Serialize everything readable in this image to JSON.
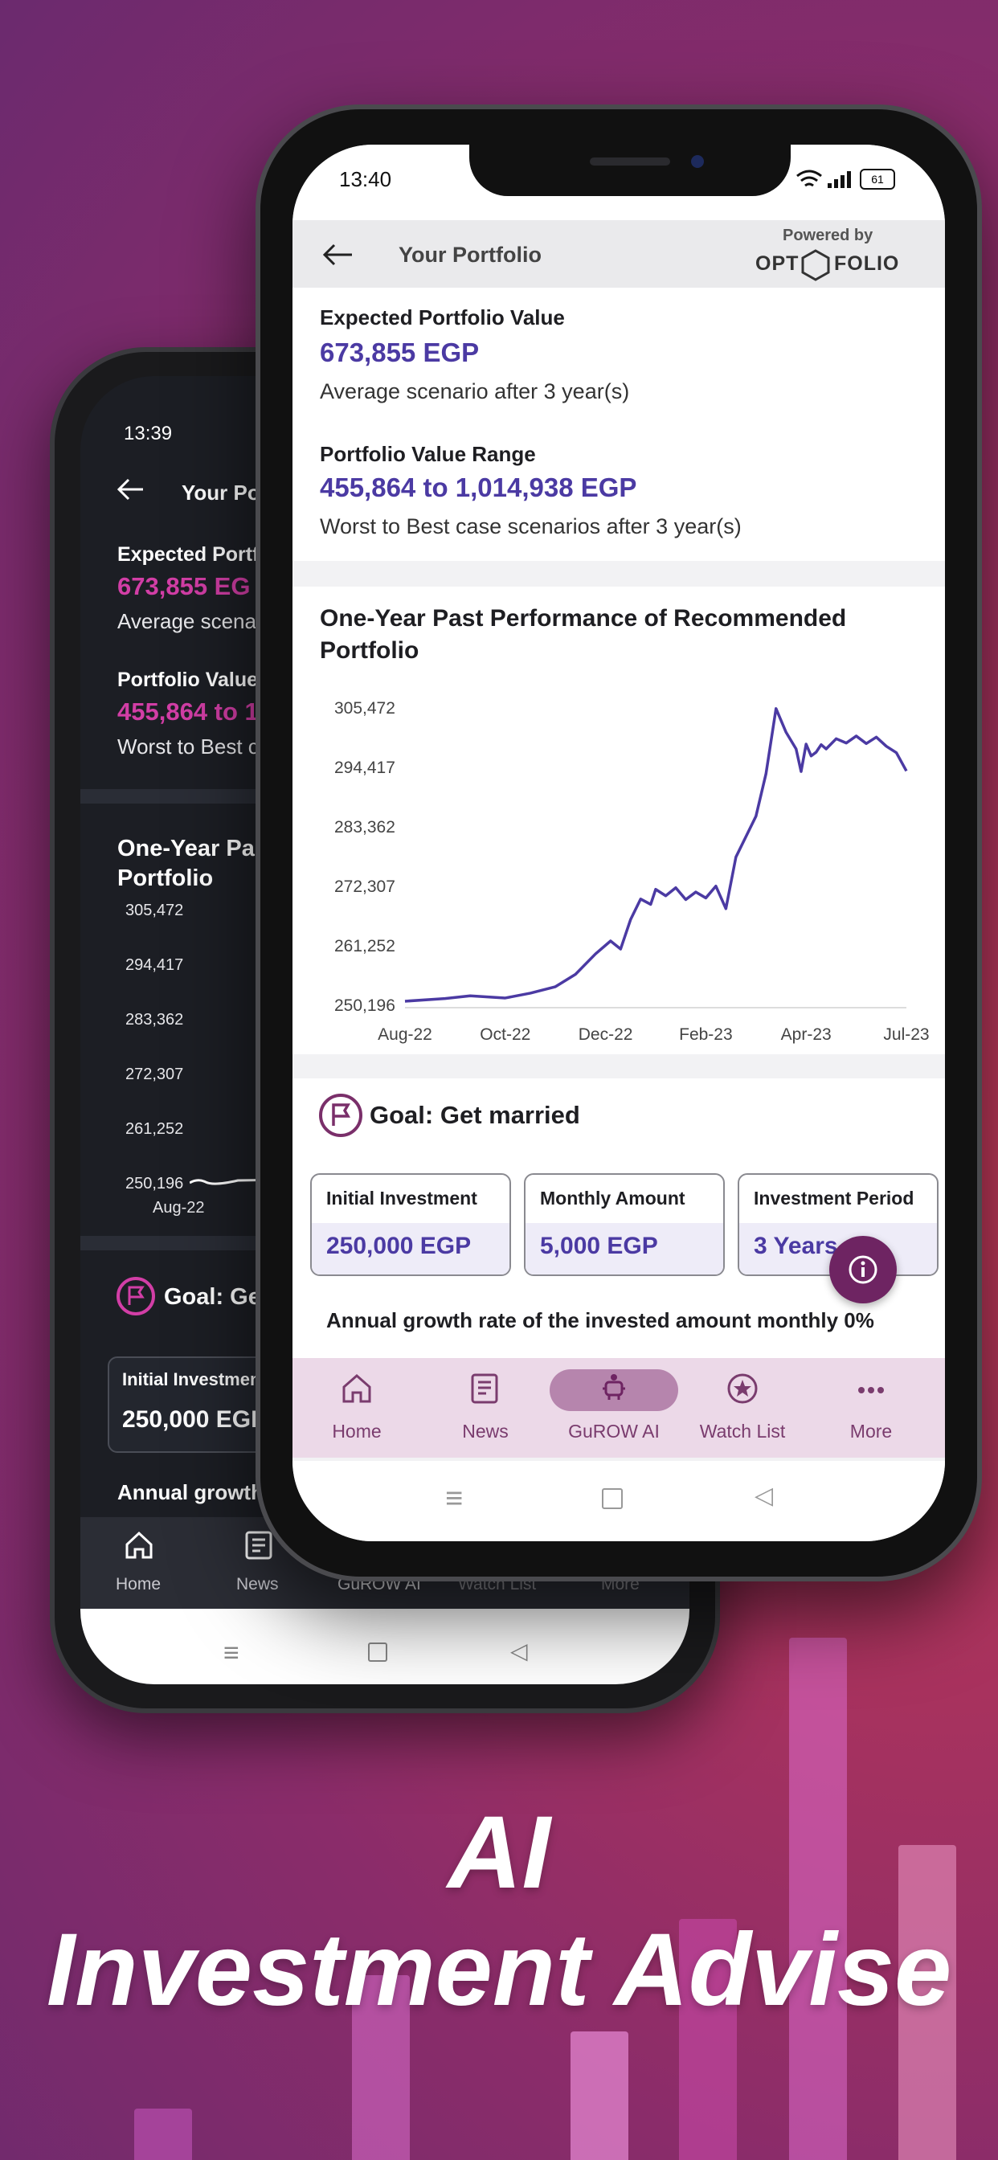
{
  "headline": {
    "line1": "AI",
    "line2": "Investment Advise"
  },
  "back_phone": {
    "time": "13:39",
    "title": "Your Po",
    "expected_label": "Expected Portf",
    "expected_value": "673,855 EG",
    "expected_sub": "Average scenar",
    "range_label": "Portfolio Value",
    "range_value": "455,864 to 1",
    "range_sub": "Worst to Best c",
    "chart_title": "One-Year Pas Portfolio",
    "y_ticks": [
      "305,472",
      "294,417",
      "283,362",
      "272,307",
      "261,252",
      "250,196"
    ],
    "x_tick": "Aug-22",
    "goal": "Goal: Get",
    "initial_label": "Initial Investment",
    "initial_value": "250,000 EGP",
    "annual": "Annual growth",
    "nav": [
      "Home",
      "News",
      "GuROW AI",
      "Watch List",
      "More"
    ]
  },
  "front_phone": {
    "status": {
      "time": "13:40",
      "battery": "61"
    },
    "header": {
      "title": "Your Portfolio",
      "powered_by": "Powered by",
      "brand_left": "OPT",
      "brand_right": "FOLIO"
    },
    "summary": {
      "expected_label": "Expected Portfolio Value",
      "expected_value": "673,855 EGP",
      "expected_sub": "Average scenario after 3 year(s)",
      "range_label": "Portfolio Value Range",
      "range_value": "455,864 to 1,014,938 EGP",
      "range_sub": "Worst to Best case scenarios after 3 year(s)"
    },
    "goal": {
      "title": "Goal: Get married",
      "cards": [
        {
          "label": "Initial Investment",
          "value": "250,000 EGP"
        },
        {
          "label": "Monthly Amount",
          "value": "5,000 EGP"
        },
        {
          "label": "Investment Period",
          "value": "3 Years"
        }
      ],
      "annual": "Annual growth rate of the invested amount monthly 0%"
    },
    "nav": [
      {
        "label": "Home",
        "icon": "home-icon"
      },
      {
        "label": "News",
        "icon": "news-icon"
      },
      {
        "label": "GuROW AI",
        "icon": "robot-icon"
      },
      {
        "label": "Watch List",
        "icon": "star-icon"
      },
      {
        "label": "More",
        "icon": "more-icon"
      }
    ],
    "colors": {
      "accent": "#4b3aa3",
      "nav_bg": "#ecd9e8",
      "brand": "#7a2f6a"
    }
  },
  "chart_data": {
    "type": "line",
    "title": "One-Year Past Performance of Recommended Portfolio",
    "x_ticks": [
      "Aug-22",
      "Oct-22",
      "Dec-22",
      "Feb-23",
      "Apr-23",
      "Jul-23"
    ],
    "y_ticks": [
      "305,472",
      "294,417",
      "283,362",
      "272,307",
      "261,252",
      "250,196"
    ],
    "ylim": [
      250196,
      305472
    ],
    "grid": false,
    "series": [
      {
        "color": "#4b3aa3",
        "x": [
          0,
          0.08,
          0.13,
          0.2,
          0.25,
          0.3,
          0.34,
          0.38,
          0.41,
          0.43,
          0.45,
          0.47,
          0.49,
          0.5,
          0.52,
          0.54,
          0.56,
          0.58,
          0.6,
          0.62,
          0.64,
          0.66,
          0.68,
          0.7,
          0.72,
          0.74,
          0.76,
          0.78,
          0.79,
          0.8,
          0.81,
          0.82,
          0.83,
          0.84,
          0.86,
          0.88,
          0.9,
          0.92,
          0.94,
          0.96,
          0.98,
          1.0
        ],
        "y": [
          250800,
          251300,
          251800,
          251400,
          252300,
          253500,
          255800,
          259600,
          262000,
          260500,
          266000,
          269800,
          268800,
          271600,
          270400,
          271900,
          269700,
          271100,
          270000,
          272200,
          268000,
          277600,
          281400,
          285200,
          293100,
          305200,
          300800,
          297700,
          293500,
          298600,
          296400,
          297100,
          298500,
          297700,
          299600,
          298800,
          300100,
          298700,
          299900,
          298200,
          297000,
          293600
        ]
      }
    ]
  }
}
